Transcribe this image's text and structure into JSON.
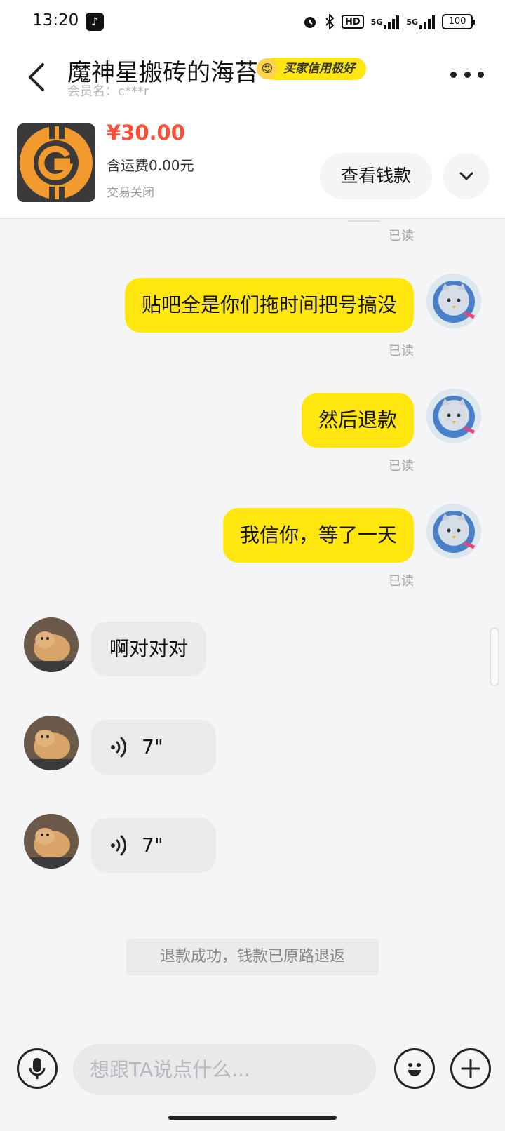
{
  "status_bar": {
    "time": "13:20",
    "network_1": "5G",
    "network_2": "5G",
    "hd_label": "HD",
    "battery": "100"
  },
  "header": {
    "title": "魔神星搬砖的海苔",
    "credit_badge": "买家信用极好",
    "member_id": "会员名：c***r"
  },
  "product": {
    "price": "¥30.00",
    "shipping": "含运费0.00元",
    "status": "交易关闭",
    "view_money_label": "查看钱款"
  },
  "chat": {
    "read_label": "已读",
    "messages_out": [
      "贴吧全是你们拖时间把号搞没",
      "然后退款",
      "我信你，等了一天"
    ],
    "messages_in": [
      "啊对对对"
    ],
    "voice_messages": [
      "7\"",
      "7\""
    ],
    "system_message": "退款成功，钱款已原路退返"
  },
  "input_bar": {
    "placeholder": "想跟TA说点什么..."
  },
  "colors": {
    "accent_yellow": "#ffe60f",
    "price_red": "#ff4c34"
  },
  "icons": {
    "back": "chevron-left-icon",
    "more": "more-dots-icon",
    "expand": "chevron-down-icon",
    "voice_wave": "voice-wave-icon",
    "mic": "mic-icon",
    "emoji": "emoji-icon",
    "plus": "plus-icon"
  }
}
